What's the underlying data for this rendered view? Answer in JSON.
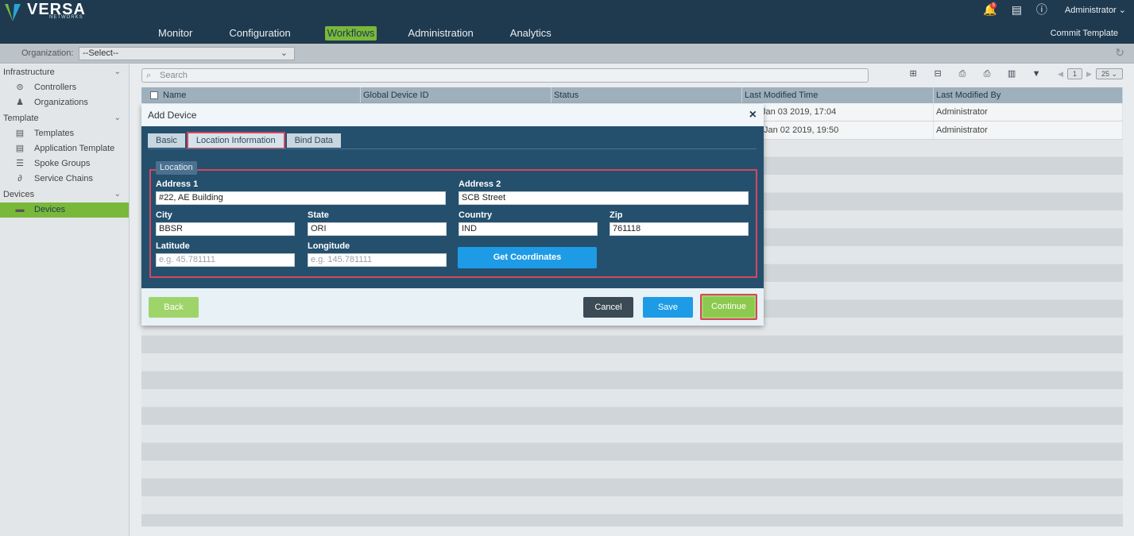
{
  "brand": {
    "name": "VERSA",
    "sub": "NETWORKS"
  },
  "nav": {
    "items": [
      "Monitor",
      "Configuration",
      "Workflows",
      "Administration",
      "Analytics"
    ],
    "active": "Workflows"
  },
  "top": {
    "notification_count": "5",
    "user": "Administrator",
    "commit": "Commit Template"
  },
  "org": {
    "label": "Organization:",
    "value": "--Select--"
  },
  "sidebar": {
    "sections": [
      {
        "label": "Infrastructure",
        "items": [
          "Controllers",
          "Organizations"
        ]
      },
      {
        "label": "Template",
        "items": [
          "Templates",
          "Application Template",
          "Spoke Groups",
          "Service Chains"
        ]
      },
      {
        "label": "Devices",
        "items": [
          "Devices"
        ]
      }
    ],
    "active": "Devices"
  },
  "search": {
    "placeholder": "Search"
  },
  "pager": {
    "page": "1",
    "size": "25"
  },
  "table": {
    "columns": [
      "Name",
      "Global Device ID",
      "Status",
      "Last Modified Time",
      "Last Modified By"
    ],
    "rows": [
      [
        "",
        "",
        "",
        "Jan 03 2019, 17:04",
        "Administrator"
      ],
      [
        "",
        "",
        "",
        "Jan 02 2019, 19:50",
        "Administrator"
      ]
    ]
  },
  "modal": {
    "title": "Add Device",
    "tabs": [
      "Basic",
      "Location Information",
      "Bind Data"
    ],
    "active_tab": "Location Information",
    "section": "Location",
    "fields": {
      "address1": {
        "label": "Address 1",
        "value": "#22, AE Building"
      },
      "address2": {
        "label": "Address 2",
        "value": "SCB Street"
      },
      "city": {
        "label": "City",
        "value": "BBSR"
      },
      "state": {
        "label": "State",
        "value": "ORI"
      },
      "country": {
        "label": "Country",
        "value": "IND"
      },
      "zip": {
        "label": "Zip",
        "value": "761118"
      },
      "latitude": {
        "label": "Latitude",
        "placeholder": "e.g. 45.781111"
      },
      "longitude": {
        "label": "Longitude",
        "placeholder": "e.g. 145.781111"
      }
    },
    "get_coordinates": "Get Coordinates",
    "buttons": {
      "back": "Back",
      "cancel": "Cancel",
      "save": "Save",
      "continue": "Continue"
    }
  },
  "colors": {
    "header": "#1f3a4f",
    "accent": "#7ab83a",
    "primary": "#1e9be6",
    "highlight": "#d9455e"
  }
}
